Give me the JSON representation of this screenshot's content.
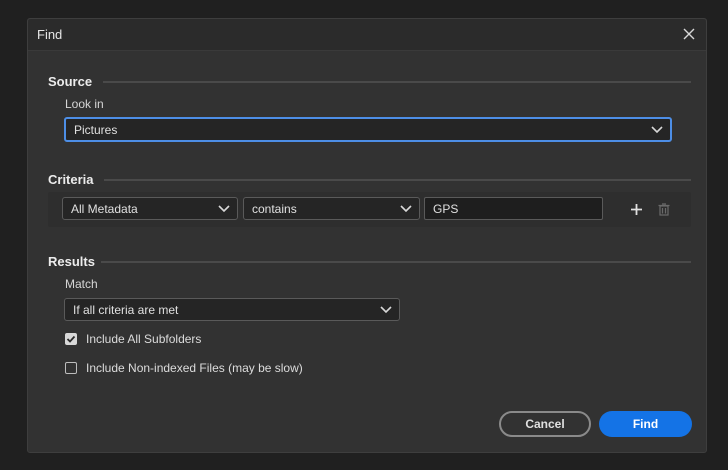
{
  "dialog": {
    "title": "Find"
  },
  "source": {
    "section_label": "Source",
    "look_in_label": "Look in",
    "look_in_value": "Pictures"
  },
  "criteria": {
    "section_label": "Criteria",
    "field_value": "All Metadata",
    "operator_value": "contains",
    "text_value": "GPS"
  },
  "results": {
    "section_label": "Results",
    "match_label": "Match",
    "match_value": "If all criteria are met",
    "include_subfolders_label": "Include All Subfolders",
    "include_subfolders_checked": true,
    "include_nonindexed_label": "Include Non-indexed Files (may be slow)",
    "include_nonindexed_checked": false
  },
  "buttons": {
    "cancel_label": "Cancel",
    "find_label": "Find"
  },
  "colors": {
    "primary_button": "#1473e6",
    "focus_ring": "#4d8ee6",
    "dialog_bg": "#323232"
  }
}
